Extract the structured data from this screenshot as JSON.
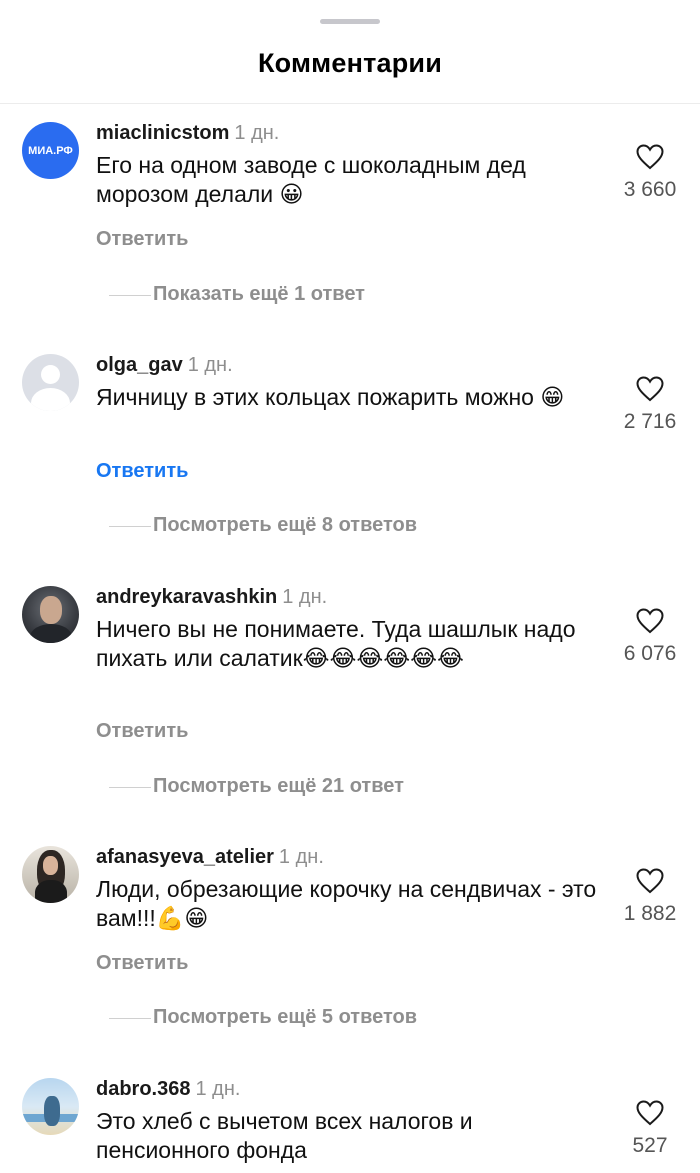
{
  "header": {
    "title": "Комментарии"
  },
  "comments": [
    {
      "username": "miaclinicstom",
      "time": "1 дн.",
      "avatar_text": "МИА.РФ",
      "text": "Его на одном заводе с шоколадным дед морозом делали 😀",
      "reply_label": "Ответить",
      "likes": "3 660",
      "more_replies": "Показать ещё 1 ответ"
    },
    {
      "username": "olga_gav",
      "time": "1 дн.",
      "text": "Яичницу в этих кольцах пожарить можно 😁",
      "reply_label": "Ответить",
      "likes": "2 716",
      "more_replies": "Посмотреть ещё 8 ответов"
    },
    {
      "username": "andreykaravashkin",
      "time": "1 дн.",
      "text": "Ничего вы не понимаете. Туда шашлык надо пихать или салатик😂😂😂😂😂😂",
      "reply_label": "Ответить",
      "likes": "6 076",
      "more_replies": "Посмотреть ещё 21 ответ"
    },
    {
      "username": "afanasyeva_atelier",
      "time": "1 дн.",
      "text": "Люди, обрезающие корочку на сендвичах - это вам!!!💪😁",
      "reply_label": "Ответить",
      "likes": "1 882",
      "more_replies": "Посмотреть ещё 5 ответов"
    },
    {
      "username": "dabro.368",
      "time": "1 дн.",
      "text": "Это хлеб с вычетом всех налогов и пенсионного фонда",
      "likes": "527"
    }
  ],
  "colors": {
    "accent_link": "#1877f2",
    "muted_text": "#8e8e8e",
    "mia_avatar": "#2a6cf0"
  }
}
